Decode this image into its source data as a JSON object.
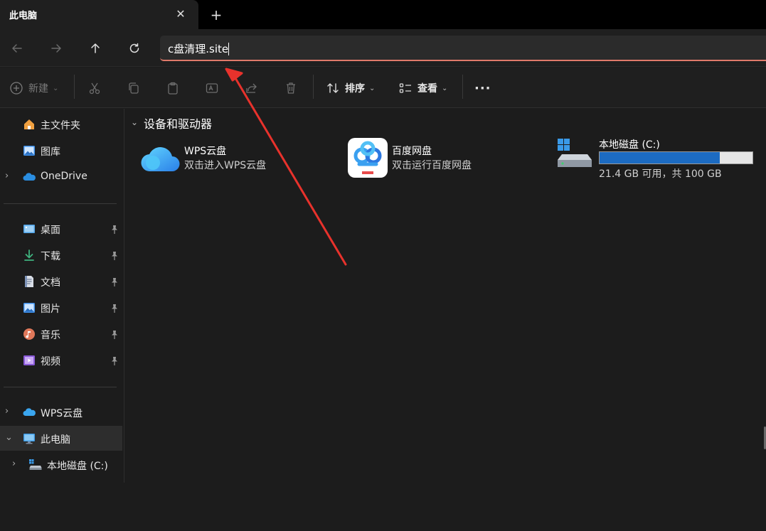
{
  "tab": {
    "title": "此电脑",
    "close_glyph": "✕",
    "new_glyph": "+"
  },
  "address": {
    "value": "c盘清理.site"
  },
  "toolbar": {
    "new_label": "新建",
    "sort_label": "排序",
    "view_label": "查看",
    "more_glyph": "···"
  },
  "sidebar": {
    "top": [
      {
        "label": "主文件夹",
        "icon": "home-icon"
      },
      {
        "label": "图库",
        "icon": "gallery-icon"
      },
      {
        "label": "OneDrive",
        "icon": "onedrive-icon"
      }
    ],
    "pinned": [
      {
        "label": "桌面",
        "icon": "desktop-folder-icon"
      },
      {
        "label": "下载",
        "icon": "download-icon"
      },
      {
        "label": "文档",
        "icon": "document-icon"
      },
      {
        "label": "图片",
        "icon": "pictures-icon"
      },
      {
        "label": "音乐",
        "icon": "music-icon"
      },
      {
        "label": "视频",
        "icon": "video-icon"
      }
    ],
    "bottom": [
      {
        "label": "WPS云盘",
        "icon": "wps-cloud-icon"
      },
      {
        "label": "此电脑",
        "icon": "this-pc-icon"
      },
      {
        "label": "本地磁盘 (C:)",
        "icon": "drive-icon"
      }
    ]
  },
  "content": {
    "group_title": "设备和驱动器",
    "tiles": [
      {
        "name": "WPS云盘",
        "sub": "双击进入WPS云盘",
        "icon": "wps-cloud-icon"
      },
      {
        "name": "百度网盘",
        "sub": "双击运行百度网盘",
        "icon": "baidu-netdisk-icon"
      },
      {
        "name": "本地磁盘 (C:)",
        "sub": "21.4 GB 可用，共 100 GB",
        "icon": "local-disk-icon",
        "used_fraction": 0.786
      }
    ]
  },
  "colors": {
    "accent_bar": "#1c6bc2",
    "annotation_arrow": "#e8322c",
    "address_underline": "#e07a6a"
  }
}
